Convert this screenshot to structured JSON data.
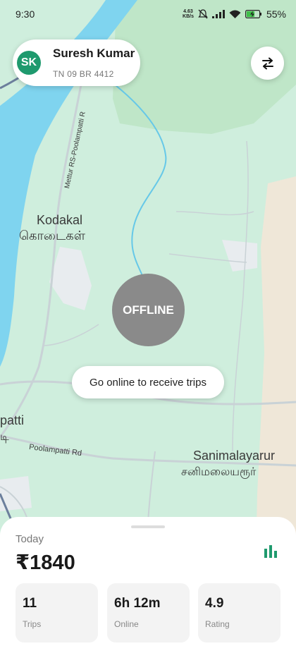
{
  "status_bar": {
    "time": "9:30",
    "net_speed_value": "4.63",
    "net_speed_unit": "KB/s",
    "battery": "55%"
  },
  "driver": {
    "initials": "SK",
    "name": "Suresh Kumar",
    "plate": "TN 09 BR 4412"
  },
  "map": {
    "labels": {
      "road_mettur": "Mettur RS-Poolampatti R",
      "kodakal_en": "Kodakal",
      "kodakal_ta": "கொடைகள்",
      "patti_en": "patti",
      "patti_ta": "டி",
      "poolampatti_rd": "Poolampatti Rd",
      "sanimalayarur_en": "Sanimalayarur",
      "sanimalayarur_ta": "சனிமலையரூர்"
    },
    "colors": {
      "land": "#cfeedd",
      "water": "#7fd4ef",
      "forest": "#bfe6c8",
      "road": "#c9d2d6"
    }
  },
  "status_button": {
    "label": "OFFLINE",
    "color": "#8a8a8a"
  },
  "hint": "Go online to receive trips",
  "earnings": {
    "period": "Today",
    "amount": "₹1840",
    "stats": [
      {
        "value": "11",
        "label": "Trips"
      },
      {
        "value": "6h 12m",
        "label": "Online"
      },
      {
        "value": "4.9",
        "label": "Rating"
      }
    ],
    "accent": "#1f9a6e"
  },
  "icons": {
    "swap": "swap-arrows-icon",
    "chart": "bar-chart-icon"
  }
}
